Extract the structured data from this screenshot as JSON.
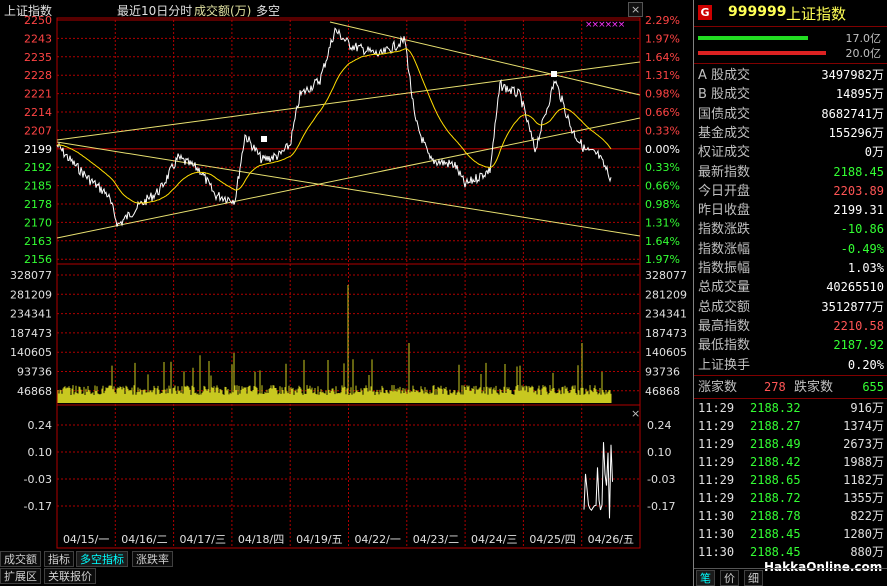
{
  "header": {
    "index_name": "上证指数",
    "period": "最近10日分时",
    "volume_label": "成交额(万)",
    "indicator": "多空"
  },
  "price_axis": [
    "2250",
    "2243",
    "2235",
    "2228",
    "2221",
    "2214",
    "2207",
    "2199",
    "2192",
    "2185",
    "2178",
    "2170",
    "2163",
    "2156"
  ],
  "pct_axis": [
    "2.29%",
    "1.97%",
    "1.64%",
    "1.31%",
    "0.98%",
    "0.66%",
    "0.33%",
    "0.00%",
    "0.33%",
    "0.66%",
    "0.98%",
    "1.31%",
    "1.64%",
    "1.97%"
  ],
  "volume_axis": [
    "328077",
    "281209",
    "234341",
    "187473",
    "140605",
    "93736",
    "46868"
  ],
  "osc_axis": [
    "0.24",
    "0.10",
    "-0.03",
    "-0.17"
  ],
  "date_axis": [
    "04/15/一",
    "04/16/二",
    "04/17/三",
    "04/18/四",
    "04/19/五",
    "04/22/一",
    "04/23/二",
    "04/24/三",
    "04/25/四",
    "04/26/五"
  ],
  "legend_marker": "××××××",
  "buttons": {
    "plus": "+",
    "minus": "-",
    "close": "×",
    "top_close": "×"
  },
  "tabs": [
    "成交额",
    "指标",
    "多空指标",
    "涨跌率"
  ],
  "tabs_row2": [
    "扩展区",
    "关联报价"
  ],
  "panel": {
    "badge": "G",
    "code": "999999",
    "name": "上证指数",
    "bar1_value": "17.0亿",
    "bar2_value": "20.0亿",
    "stats": [
      {
        "label": "A 股成交",
        "value": "3497982万",
        "color": "#ffffff"
      },
      {
        "label": "B 股成交",
        "value": "14895万",
        "color": "#ffffff"
      },
      {
        "label": "国债成交",
        "value": "8682741万",
        "color": "#ffffff"
      },
      {
        "label": "基金成交",
        "value": "155296万",
        "color": "#ffffff"
      },
      {
        "label": "权证成交",
        "value": "0万",
        "color": "#ffffff"
      },
      {
        "label": "最新指数",
        "value": "2188.45",
        "color": "#33ff33"
      },
      {
        "label": "今日开盘",
        "value": "2203.89",
        "color": "#ff5555"
      },
      {
        "label": "昨日收盘",
        "value": "2199.31",
        "color": "#ffffff"
      },
      {
        "label": "指数涨跌",
        "value": "-10.86",
        "color": "#33ff33"
      },
      {
        "label": "指数涨幅",
        "value": "-0.49%",
        "color": "#33ff33"
      },
      {
        "label": "指数振幅",
        "value": "1.03%",
        "color": "#ffffff"
      },
      {
        "label": "总成交量",
        "value": "40265510",
        "color": "#ffffff"
      },
      {
        "label": "总成交额",
        "value": "3512877万",
        "color": "#ffffff"
      },
      {
        "label": "最高指数",
        "value": "2210.58",
        "color": "#ff5555"
      },
      {
        "label": "最低指数",
        "value": "2187.92",
        "color": "#33ff33"
      },
      {
        "label": "上证换手",
        "value": "0.20%",
        "color": "#ffffff"
      }
    ],
    "updown": {
      "up_label": "涨家数",
      "up_value": "278",
      "down_label": "跌家数",
      "down_value": "655"
    },
    "ticks": [
      {
        "time": "11:29",
        "price": "2188.32",
        "vol": "916万"
      },
      {
        "time": "11:29",
        "price": "2188.27",
        "vol": "1374万"
      },
      {
        "time": "11:29",
        "price": "2188.49",
        "vol": "2673万"
      },
      {
        "time": "11:29",
        "price": "2188.42",
        "vol": "1988万"
      },
      {
        "time": "11:29",
        "price": "2188.65",
        "vol": "1182万"
      },
      {
        "time": "11:29",
        "price": "2188.72",
        "vol": "1355万"
      },
      {
        "time": "11:30",
        "price": "2188.78",
        "vol": "822万"
      },
      {
        "time": "11:30",
        "price": "2188.45",
        "vol": "1280万"
      },
      {
        "time": "11:30",
        "price": "2188.45",
        "vol": "880万"
      }
    ],
    "bottom_tabs": [
      "笔",
      "价",
      "细"
    ],
    "watermark": "HakkaOnline.com"
  }
}
